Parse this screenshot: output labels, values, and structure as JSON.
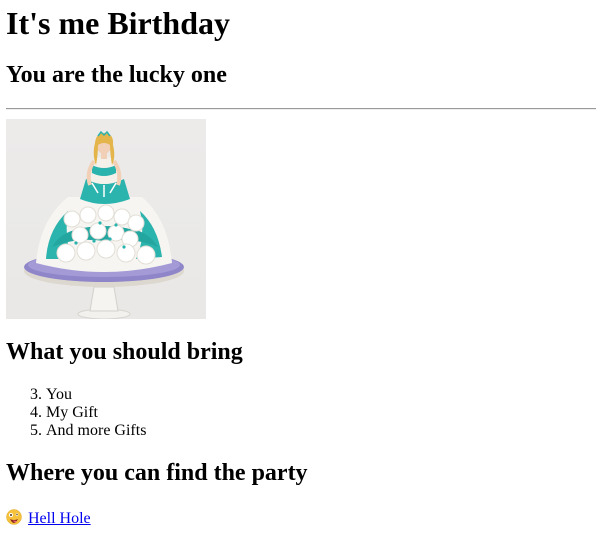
{
  "header": {
    "title": "It's me Birthday",
    "subtitle": "You are the lucky one"
  },
  "image": {
    "icon": "doll-cake-image",
    "colors": {
      "background": "#ebeae8",
      "frosting_teal": "#2bb3ad",
      "frosting_white": "#f7f5f1",
      "plate_purple": "#8f86c9",
      "stand": "#f4f3f0"
    }
  },
  "bring": {
    "heading": "What you should bring",
    "start": 3,
    "items": [
      "You",
      "My Gift",
      "And more Gifts"
    ]
  },
  "location": {
    "heading": "Where you can find the party",
    "emoji": "crazy-face-emoji",
    "link_text": "Hell Hole",
    "link_color": "#0000ee"
  }
}
